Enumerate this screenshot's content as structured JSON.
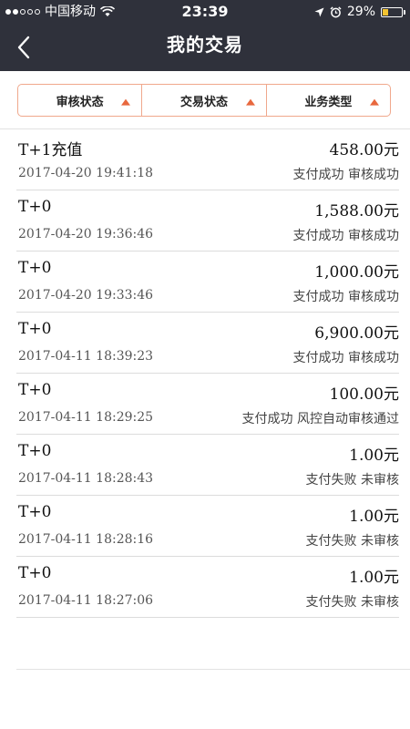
{
  "status_bar": {
    "carrier": "中国移动",
    "time": "23:39",
    "battery_percent": "29%",
    "battery_level": 0.29,
    "icons": [
      "wifi-icon",
      "location-icon",
      "alarm-icon",
      "battery-icon"
    ]
  },
  "nav": {
    "title": "我的交易",
    "back_icon": "chevron-left-icon"
  },
  "filters": [
    {
      "label": "审核状态"
    },
    {
      "label": "交易状态"
    },
    {
      "label": "业务类型"
    }
  ],
  "transactions": [
    {
      "name": "T+1充值",
      "amount": "458.00元",
      "time": "2017-04-20 19:41:18",
      "status": "支付成功 审核成功"
    },
    {
      "name": "T+0",
      "amount": "1,588.00元",
      "time": "2017-04-20 19:36:46",
      "status": "支付成功 审核成功"
    },
    {
      "name": "T+0",
      "amount": "1,000.00元",
      "time": "2017-04-20 19:33:46",
      "status": "支付成功 审核成功"
    },
    {
      "name": "T+0",
      "amount": "6,900.00元",
      "time": "2017-04-11 18:39:23",
      "status": "支付成功 审核成功"
    },
    {
      "name": "T+0",
      "amount": "100.00元",
      "time": "2017-04-11 18:29:25",
      "status": "支付成功 风控自动审核通过"
    },
    {
      "name": "T+0",
      "amount": "1.00元",
      "time": "2017-04-11 18:28:43",
      "status": "支付失败 未审核"
    },
    {
      "name": "T+0",
      "amount": "1.00元",
      "time": "2017-04-11 18:28:16",
      "status": "支付失败 未审核"
    },
    {
      "name": "T+0",
      "amount": "1.00元",
      "time": "2017-04-11 18:27:06",
      "status": "支付失败 未审核"
    }
  ],
  "colors": {
    "header_bg": "#2f313b",
    "accent": "#e8683e",
    "filter_border": "#f0a88c",
    "battery": "#f2c230"
  }
}
